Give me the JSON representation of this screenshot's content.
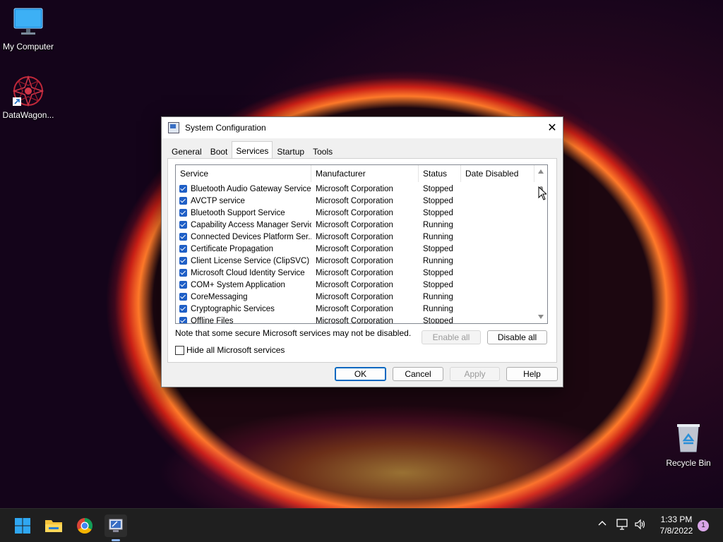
{
  "desktop": {
    "icons": [
      {
        "label": "My Computer"
      },
      {
        "label": "DataWagon..."
      },
      {
        "label": "Recycle Bin"
      }
    ]
  },
  "dialog": {
    "title": "System Configuration",
    "tabs": [
      "General",
      "Boot",
      "Services",
      "Startup",
      "Tools"
    ],
    "active_tab": "Services",
    "columns": [
      "Service",
      "Manufacturer",
      "Status",
      "Date Disabled"
    ],
    "services": [
      {
        "name": "Bluetooth Audio Gateway Service",
        "manufacturer": "Microsoft Corporation",
        "status": "Stopped",
        "date_disabled": ""
      },
      {
        "name": "AVCTP service",
        "manufacturer": "Microsoft Corporation",
        "status": "Stopped",
        "date_disabled": ""
      },
      {
        "name": "Bluetooth Support Service",
        "manufacturer": "Microsoft Corporation",
        "status": "Stopped",
        "date_disabled": ""
      },
      {
        "name": "Capability Access Manager Service",
        "manufacturer": "Microsoft Corporation",
        "status": "Running",
        "date_disabled": ""
      },
      {
        "name": "Connected Devices Platform Ser...",
        "manufacturer": "Microsoft Corporation",
        "status": "Running",
        "date_disabled": ""
      },
      {
        "name": "Certificate Propagation",
        "manufacturer": "Microsoft Corporation",
        "status": "Stopped",
        "date_disabled": ""
      },
      {
        "name": "Client License Service (ClipSVC)",
        "manufacturer": "Microsoft Corporation",
        "status": "Running",
        "date_disabled": ""
      },
      {
        "name": "Microsoft Cloud Identity Service",
        "manufacturer": "Microsoft Corporation",
        "status": "Stopped",
        "date_disabled": ""
      },
      {
        "name": "COM+ System Application",
        "manufacturer": "Microsoft Corporation",
        "status": "Stopped",
        "date_disabled": ""
      },
      {
        "name": "CoreMessaging",
        "manufacturer": "Microsoft Corporation",
        "status": "Running",
        "date_disabled": ""
      },
      {
        "name": "Cryptographic Services",
        "manufacturer": "Microsoft Corporation",
        "status": "Running",
        "date_disabled": ""
      },
      {
        "name": "Offline Files",
        "manufacturer": "Microsoft Corporation",
        "status": "Stopped",
        "date_disabled": ""
      }
    ],
    "note": "Note that some secure Microsoft services may not be disabled.",
    "enable_all": "Enable all",
    "disable_all": "Disable all",
    "hide_ms_label": "Hide all Microsoft services",
    "ok": "OK",
    "cancel": "Cancel",
    "apply": "Apply",
    "help": "Help"
  },
  "taskbar": {
    "time": "1:33 PM",
    "date": "7/8/2022",
    "notification_count": "1",
    "pinned": [
      "start-icon",
      "file-explorer-icon",
      "chrome-icon",
      "system-configuration-icon"
    ]
  },
  "colors": {
    "accent": "#0067c0",
    "checkbox": "#1f5fc6",
    "taskbar": "#1f1f1f",
    "badge": "#d9a6e8"
  }
}
